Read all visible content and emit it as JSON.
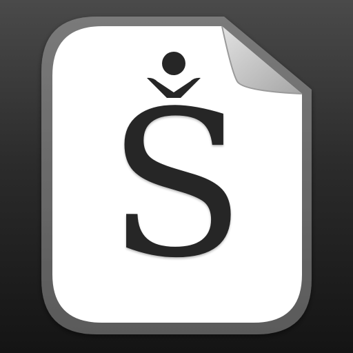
{
  "icon": {
    "semantic": "document-file-icon",
    "letter": "S",
    "caron_mark": "caron-icon",
    "head_mark": "figure-head-icon"
  },
  "colors": {
    "background_top": "#4a4a4a",
    "background_bottom": "#141414",
    "page_border": "#666666",
    "page_fill": "#ffffff",
    "page_fold": "#c6c6c6",
    "glyph": "#262626"
  }
}
